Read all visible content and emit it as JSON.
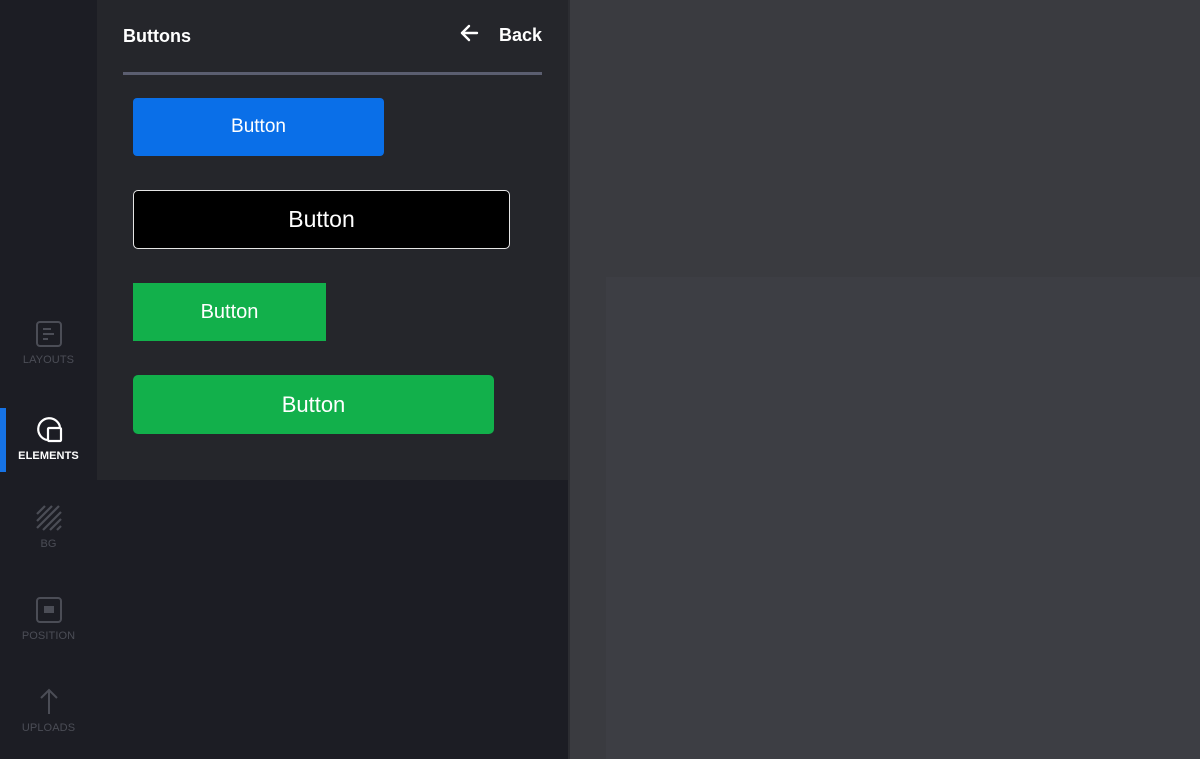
{
  "sidebar": {
    "items": [
      {
        "label": "LAYOUTS",
        "icon": "layouts-icon",
        "active": false
      },
      {
        "label": "ELEMENTS",
        "icon": "elements-icon",
        "active": true
      },
      {
        "label": "BG",
        "icon": "background-pattern-icon",
        "active": false
      },
      {
        "label": "POSITION",
        "icon": "position-icon",
        "active": false
      },
      {
        "label": "UPLOADS",
        "icon": "upload-arrow-icon",
        "active": false
      }
    ]
  },
  "panel": {
    "title": "Buttons",
    "back_label": "Back",
    "buttons": [
      {
        "label": "Button",
        "style": "blue-rounded"
      },
      {
        "label": "Button",
        "style": "black-outlined"
      },
      {
        "label": "Button",
        "style": "green-square"
      },
      {
        "label": "Button",
        "style": "green-rounded"
      }
    ]
  },
  "colors": {
    "accent": "#1673e6",
    "blue_button": "#0a6fe8",
    "green_button": "#12b04b",
    "panel_bg": "#25262b",
    "rail_bg": "#1c1d24",
    "canvas_bg": "#3a3b40"
  }
}
